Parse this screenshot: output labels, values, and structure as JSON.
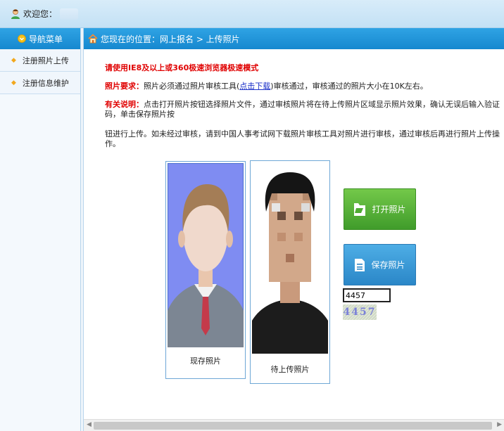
{
  "header": {
    "welcome": "欢迎您："
  },
  "sidebar": {
    "title": "导航菜单",
    "items": [
      {
        "label": "注册照片上传"
      },
      {
        "label": "注册信息维护"
      }
    ]
  },
  "breadcrumb": {
    "text": "您现在的位置：网上报名 > 上传照片"
  },
  "notice": {
    "ie_mode": "请使用IE8及以上或360极速浏览器极速模式",
    "req_label": "照片要求：",
    "req_text1": "照片必须通过照片审核工具(",
    "req_link": "点击下载",
    "req_text2": ")审核通过，审核通过的照片大小在10K左右。",
    "desc_label": "有关说明：",
    "desc_text1": "点击打开照片按钮选择照片文件，通过审核照片将在待上传照片区域显示照片效果，确认无误后输入验证码，单击保存照片按",
    "desc_text2": "钮进行上传。如未经过审核，请到中国人事考试网下载照片审核工具对照片进行审核，通过审核后再进行照片上传操作。"
  },
  "photos": {
    "current_label": "现存照片",
    "upload_label": "待上传照片"
  },
  "buttons": {
    "open": "打开照片",
    "save": "保存照片"
  },
  "captcha": {
    "value": "4457",
    "image_text": "4457"
  },
  "colors": {
    "nav_blue": "#1e93d8",
    "red": "#e00000",
    "green": "#4fab33",
    "blue_btn": "#3a9ad8"
  }
}
